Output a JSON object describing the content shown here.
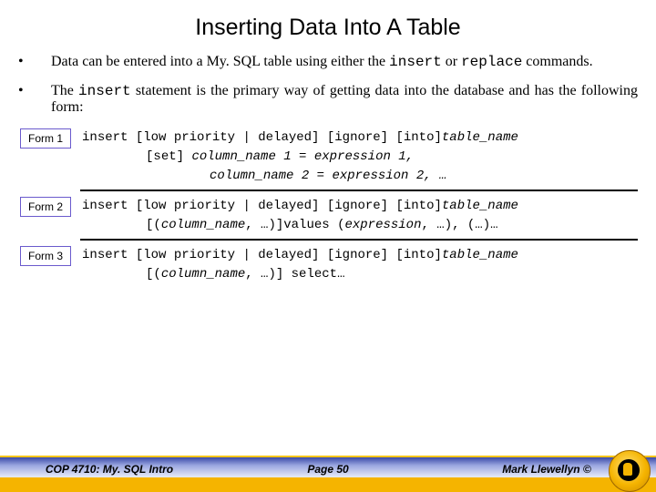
{
  "title": "Inserting Data Into A Table",
  "bullets": [
    {
      "pre": "Data can be entered into a My. SQL table using either the ",
      "code1": "insert",
      "mid": " or ",
      "code2": "replace",
      "post": " commands."
    },
    {
      "pre": "The ",
      "code1": "insert",
      "mid": " statement is the primary way of getting data into the database and has the following form:",
      "code2": "",
      "post": ""
    }
  ],
  "forms": [
    {
      "label": "Form 1",
      "line1a": "insert [low priority | delayed] [ignore] [into]",
      "line1b": "table_name",
      "line2a": "[set] ",
      "line2b": "column_name 1 = expression 1,",
      "line3": "column_name 2 = expression 2, …"
    },
    {
      "label": "Form 2",
      "line1a": "insert [low priority | delayed] [ignore] [into]",
      "line1b": "table_name",
      "line2a": "[(",
      "line2b": "column_name",
      "line2c": ", …)]values (",
      "line2d": "expression",
      "line2e": ", …), (…)…"
    },
    {
      "label": "Form 3",
      "line1a": "insert [low priority | delayed] [ignore] [into]",
      "line1b": "table_name",
      "line2a": "[(",
      "line2b": "column_name",
      "line2c": ", …)] select…"
    }
  ],
  "footer": {
    "left": "COP 4710: My. SQL Intro",
    "center": "Page 50",
    "right": "Mark Llewellyn ©"
  }
}
